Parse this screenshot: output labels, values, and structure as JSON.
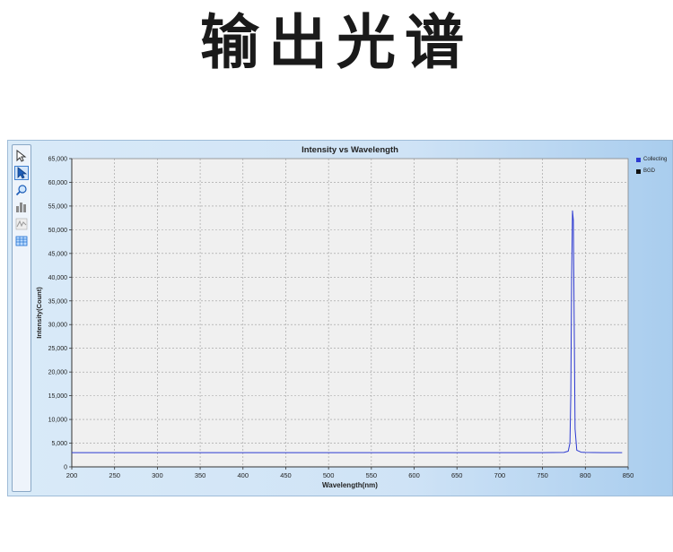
{
  "page": {
    "heading": "输出光谱"
  },
  "toolbar": {
    "tools": [
      {
        "name": "pointer-tool",
        "active": false
      },
      {
        "name": "select-tool",
        "active": true
      },
      {
        "name": "zoom-tool",
        "active": false
      },
      {
        "name": "histogram-tool",
        "active": false
      },
      {
        "name": "spectrum-tool",
        "active": false
      },
      {
        "name": "table-tool",
        "active": false
      }
    ]
  },
  "chart_data": {
    "type": "line",
    "title": "Intensity vs Wavelength",
    "xlabel": "Wavelength(nm)",
    "ylabel": "Intensity(Count)",
    "xlim": [
      200,
      850
    ],
    "ylim": [
      0,
      65000
    ],
    "x_ticks": [
      200,
      250,
      300,
      350,
      400,
      450,
      500,
      550,
      600,
      650,
      700,
      750,
      800,
      850
    ],
    "x_tick_labels": [
      "200",
      "250",
      "300",
      "350",
      "400",
      "450",
      "500",
      "550",
      "600",
      "650",
      "700",
      "750",
      "800",
      "850"
    ],
    "y_ticks": [
      0,
      5000,
      10000,
      15000,
      20000,
      25000,
      30000,
      35000,
      40000,
      45000,
      50000,
      55000,
      60000,
      65000
    ],
    "y_tick_labels": [
      "0",
      "5,000",
      "10,000",
      "15,000",
      "20,000",
      "25,000",
      "30,000",
      "35,000",
      "40,000",
      "45,000",
      "50,000",
      "55,000",
      "60,000",
      "65,000"
    ],
    "grid": true,
    "legend_position": "top-right",
    "series": [
      {
        "name": "Collecting",
        "color": "#2d3ad1",
        "x": [
          200,
          250,
          300,
          350,
          400,
          450,
          500,
          550,
          600,
          650,
          700,
          750,
          775,
          780,
          782,
          783,
          784,
          785,
          786,
          787,
          788,
          790,
          795,
          800,
          820,
          843
        ],
        "y": [
          3000,
          3000,
          3000,
          3000,
          3000,
          3000,
          3000,
          3000,
          3000,
          3000,
          3000,
          3000,
          3050,
          3300,
          5000,
          15000,
          40000,
          54000,
          52000,
          30000,
          8000,
          3500,
          3100,
          3050,
          3000,
          3000
        ]
      },
      {
        "name": "BGD",
        "color": "#111111",
        "x": [],
        "y": []
      }
    ]
  }
}
